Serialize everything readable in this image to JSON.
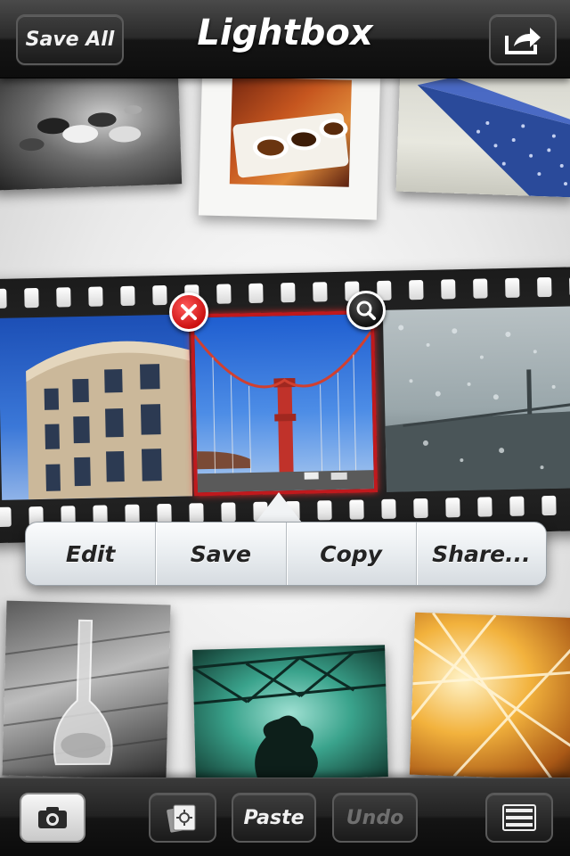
{
  "app": {
    "title": "Lightbox"
  },
  "header": {
    "save_all_label": "Save All",
    "export_icon": "share-arrow-icon"
  },
  "gallery": {
    "top_row": [
      "pigeons-photo",
      "sauce-cups-polaroid",
      "airplane-wing-photo"
    ],
    "bottom_row": [
      "glass-bottle-photo",
      "steel-truss-photo",
      "golden-roof-photo"
    ]
  },
  "filmstrip": {
    "frames": [
      "round-building-photo",
      "golden-gate-bridge-photo",
      "rainy-window-bridge-photo"
    ],
    "selected_frame": "golden-gate-bridge-photo",
    "selected_color": "#c0191d"
  },
  "context_menu": {
    "items": [
      "Edit",
      "Save",
      "Copy",
      "Share..."
    ]
  },
  "toolbar": {
    "camera_icon": "camera-icon",
    "library_icon": "photo-library-icon",
    "paste_label": "Paste",
    "undo_label": "Undo",
    "list_icon": "list-view-icon"
  }
}
